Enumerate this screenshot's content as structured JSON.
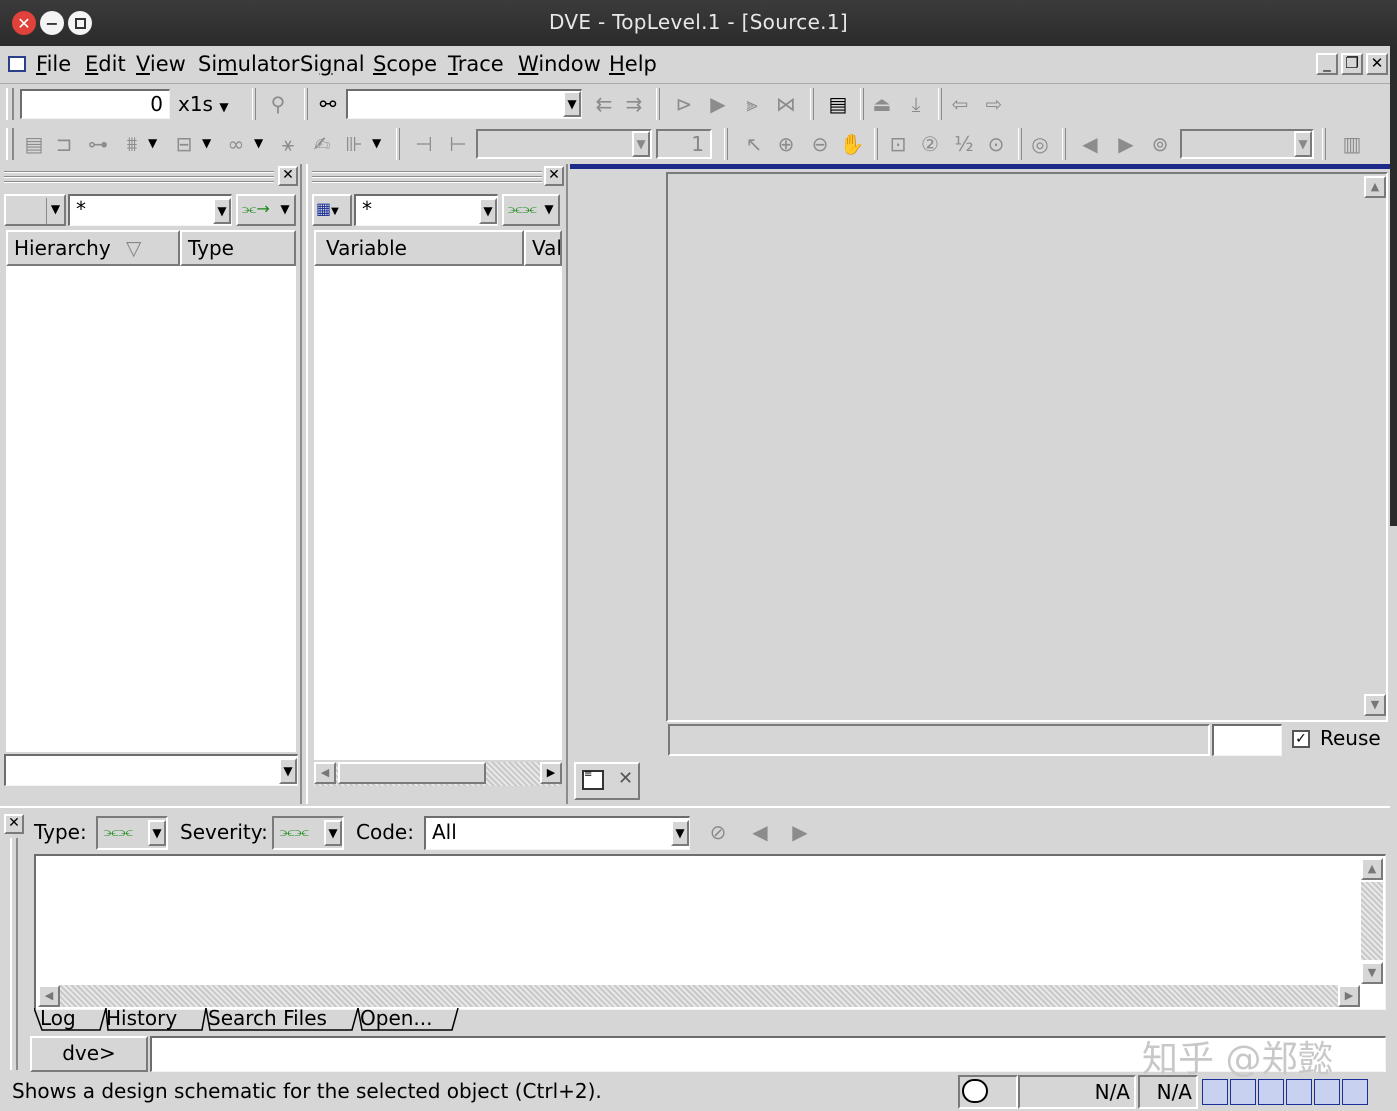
{
  "window": {
    "title": "DVE - TopLevel.1 - [Source.1]"
  },
  "menu": {
    "items": [
      "File",
      "Edit",
      "View",
      "Simulator",
      "Signal",
      "Scope",
      "Trace",
      "Window",
      "Help"
    ],
    "underline_index": [
      0,
      0,
      0,
      2,
      2,
      0,
      0,
      0,
      0
    ]
  },
  "toolbar1": {
    "time_value": "0",
    "time_unit": "x1s",
    "search_value": ""
  },
  "toolbar2": {
    "combo_value": "",
    "number_value": "1",
    "zoom_combo_value": ""
  },
  "hierarchy_pane": {
    "filter_value": "*",
    "columns": [
      "Hierarchy",
      "Type"
    ]
  },
  "variable_pane": {
    "filter_value": "*",
    "columns": [
      "Variable",
      "Val"
    ]
  },
  "source_pane": {
    "reuse_label": "Reuse",
    "reuse_checked": true
  },
  "console": {
    "type_label": "Type:",
    "severity_label": "Severity:",
    "code_label": "Code:",
    "code_value": "All",
    "tabs": [
      "Log",
      "History",
      "Search Files",
      "Open..."
    ],
    "prompt": "dve>",
    "input_value": ""
  },
  "status": {
    "message": "Shows a design schematic for the selected object (Ctrl+2).",
    "field1": "N/A",
    "field2": "N/A"
  },
  "watermark": "知乎 @郑懿"
}
